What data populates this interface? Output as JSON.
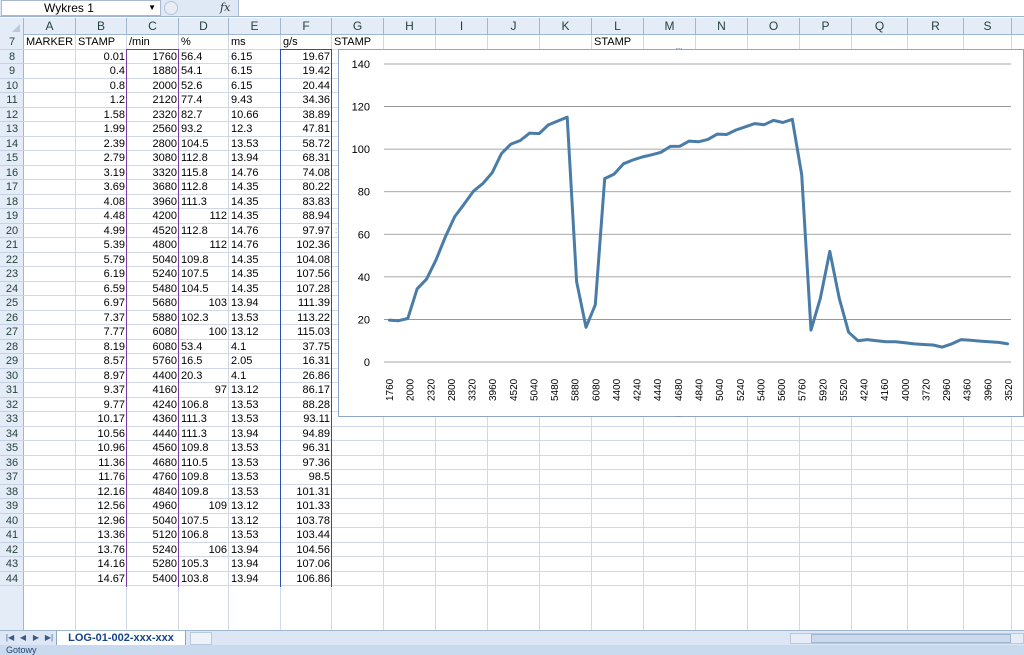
{
  "formula_bar": {
    "name_box": "Wykres 1",
    "fx": "fx"
  },
  "columns": [
    "A",
    "B",
    "C",
    "D",
    "E",
    "F",
    "G",
    "H",
    "I",
    "J",
    "K",
    "L",
    "M",
    "N",
    "O",
    "P",
    "Q",
    "R",
    "S"
  ],
  "row_numbers": [
    "7",
    "8",
    "9",
    "10",
    "11",
    "12",
    "13",
    "14",
    "15",
    "16",
    "17",
    "18",
    "19",
    "20",
    "21",
    "22",
    "23",
    "24",
    "25",
    "26",
    "27",
    "28",
    "29",
    "30",
    "31",
    "32",
    "33",
    "34",
    "35",
    "36",
    "37",
    "38",
    "39",
    "40",
    "41",
    "42",
    "43",
    "44"
  ],
  "header_row": {
    "A": "MARKER",
    "B": "STAMP",
    "C": "/min",
    "D": "%",
    "E": "ms",
    "F": "g/s",
    "G": "STAMP",
    "L": "STAMP"
  },
  "rows": [
    [
      "",
      "0.01",
      "1760",
      "56.4",
      "6.15",
      "19.67"
    ],
    [
      "",
      "0.4",
      "1880",
      "54.1",
      "6.15",
      "19.42"
    ],
    [
      "",
      "0.8",
      "2000",
      "52.6",
      "6.15",
      "20.44"
    ],
    [
      "",
      "1.2",
      "2120",
      "77.4",
      "9.43",
      "34.36"
    ],
    [
      "",
      "1.58",
      "2320",
      "82.7",
      "10.66",
      "38.89"
    ],
    [
      "",
      "1.99",
      "2560",
      "93.2",
      "12.3",
      "47.81"
    ],
    [
      "",
      "2.39",
      "2800",
      "104.5",
      "13.53",
      "58.72"
    ],
    [
      "",
      "2.79",
      "3080",
      "112.8",
      "13.94",
      "68.31"
    ],
    [
      "",
      "3.19",
      "3320",
      "115.8",
      "14.76",
      "74.08"
    ],
    [
      "",
      "3.69",
      "3680",
      "112.8",
      "14.35",
      "80.22"
    ],
    [
      "",
      "4.08",
      "3960",
      "111.3",
      "14.35",
      "83.83"
    ],
    [
      "",
      "4.48",
      "4200",
      "112",
      "14.35",
      "88.94"
    ],
    [
      "",
      "4.99",
      "4520",
      "112.8",
      "14.76",
      "97.97"
    ],
    [
      "",
      "5.39",
      "4800",
      "112",
      "14.76",
      "102.36"
    ],
    [
      "",
      "5.79",
      "5040",
      "109.8",
      "14.35",
      "104.08"
    ],
    [
      "",
      "6.19",
      "5240",
      "107.5",
      "14.35",
      "107.56"
    ],
    [
      "",
      "6.59",
      "5480",
      "104.5",
      "14.35",
      "107.28"
    ],
    [
      "",
      "6.97",
      "5680",
      "103",
      "13.94",
      "111.39"
    ],
    [
      "",
      "7.37",
      "5880",
      "102.3",
      "13.53",
      "113.22"
    ],
    [
      "",
      "7.77",
      "6080",
      "100",
      "13.12",
      "115.03"
    ],
    [
      "",
      "8.19",
      "6080",
      "53.4",
      "4.1",
      "37.75"
    ],
    [
      "",
      "8.57",
      "5760",
      "16.5",
      "2.05",
      "16.31"
    ],
    [
      "",
      "8.97",
      "4400",
      "20.3",
      "4.1",
      "26.86"
    ],
    [
      "",
      "9.37",
      "4160",
      "97",
      "13.12",
      "86.17"
    ],
    [
      "",
      "9.77",
      "4240",
      "106.8",
      "13.53",
      "88.28"
    ],
    [
      "",
      "10.17",
      "4360",
      "111.3",
      "13.53",
      "93.11"
    ],
    [
      "",
      "10.56",
      "4440",
      "111.3",
      "13.94",
      "94.89"
    ],
    [
      "",
      "10.96",
      "4560",
      "109.8",
      "13.53",
      "96.31"
    ],
    [
      "",
      "11.36",
      "4680",
      "110.5",
      "13.53",
      "97.36"
    ],
    [
      "",
      "11.76",
      "4760",
      "109.8",
      "13.53",
      "98.5"
    ],
    [
      "",
      "12.16",
      "4840",
      "109.8",
      "13.53",
      "101.31"
    ],
    [
      "",
      "12.56",
      "4960",
      "109",
      "13.12",
      "101.33"
    ],
    [
      "",
      "12.96",
      "5040",
      "107.5",
      "13.12",
      "103.78"
    ],
    [
      "",
      "13.36",
      "5120",
      "106.8",
      "13.53",
      "103.44"
    ],
    [
      "",
      "13.76",
      "5240",
      "106",
      "13.94",
      "104.56"
    ],
    [
      "",
      "14.16",
      "5280",
      "105.3",
      "13.94",
      "107.06"
    ],
    [
      "",
      "14.67",
      "5400",
      "103.8",
      "13.94",
      "106.86"
    ]
  ],
  "chart_data": {
    "type": "line",
    "title": "",
    "xlabel": "",
    "ylabel": "",
    "ylim": [
      0,
      140
    ],
    "yticks": [
      0,
      20,
      40,
      60,
      80,
      100,
      120,
      140
    ],
    "grid": true,
    "legend": "none",
    "line_color": "#4a7ca8",
    "x_tick_labels": [
      "1760",
      "2000",
      "2320",
      "2800",
      "3320",
      "3960",
      "4520",
      "5040",
      "5480",
      "5880",
      "6080",
      "4400",
      "4240",
      "4440",
      "4680",
      "4840",
      "5040",
      "5240",
      "5400",
      "5600",
      "5760",
      "5920",
      "5520",
      "4240",
      "4160",
      "4000",
      "3720",
      "2960",
      "4360",
      "3960",
      "3520"
    ],
    "series": [
      {
        "values": [
          19.67,
          19.42,
          20.44,
          34.36,
          38.89,
          47.81,
          58.72,
          68.31,
          74.08,
          80.22,
          83.83,
          88.94,
          97.97,
          102.36,
          104.08,
          107.56,
          107.28,
          111.39,
          113.22,
          115.03,
          37.75,
          16.31,
          26.86,
          86.17,
          88.28,
          93.11,
          94.89,
          96.31,
          97.36,
          98.5,
          101.31,
          101.33,
          103.78,
          103.44,
          104.56,
          107.06,
          106.86,
          109,
          110.5,
          112,
          111.5,
          113.5,
          112.5,
          114,
          88,
          15,
          30,
          52,
          30,
          14,
          10,
          10.5,
          10,
          9.5,
          9.5,
          9,
          8.5,
          8.2,
          8,
          7,
          8.5,
          10.5,
          10.2,
          9.8,
          9.5,
          9.2,
          8.5
        ]
      }
    ]
  },
  "sheet_tab": "LOG-01-002-xxx-xxx",
  "status_text": "Gotowy"
}
